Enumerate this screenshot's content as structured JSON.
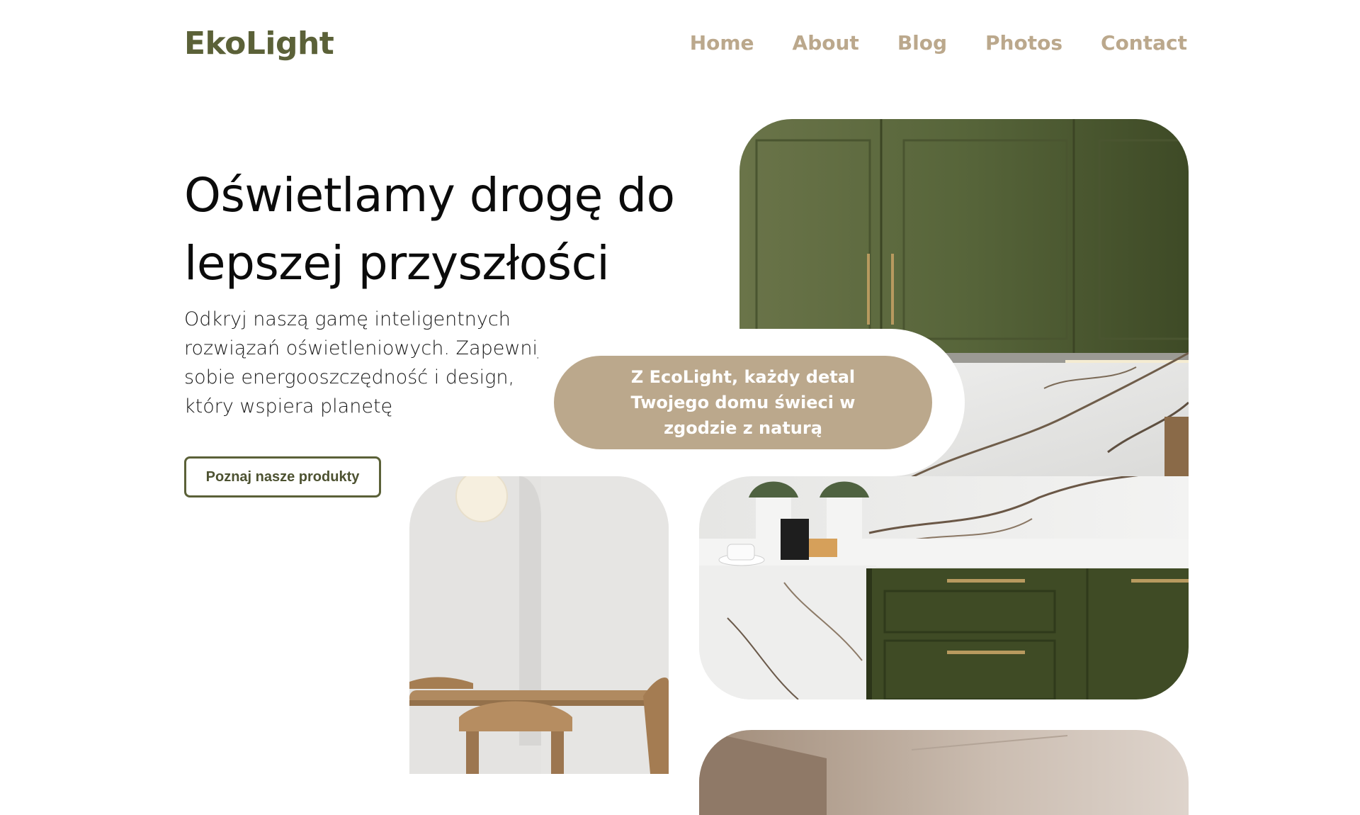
{
  "brand": {
    "logo": "EkoLight"
  },
  "nav": {
    "items": [
      "Home",
      "About",
      "Blog",
      "Photos",
      "Contact"
    ]
  },
  "hero": {
    "title": "Oświetlamy drogę do lepszej przyszłości",
    "subtitle": "Odkryj naszą gamę inteligentnych rozwiązań oświetleniowych. Zapewnij sobie energooszczędność i design, który wspiera planetę",
    "cta_label": "Poznaj nasze produkty"
  },
  "badge": {
    "text": "Z EcoLight, każdy detal Twojego domu świeci w zgodzie z naturą"
  },
  "colors": {
    "brand_olive": "#5b6138",
    "accent_tan": "#bba88c",
    "cabinet_green": "#4d5a2c"
  }
}
